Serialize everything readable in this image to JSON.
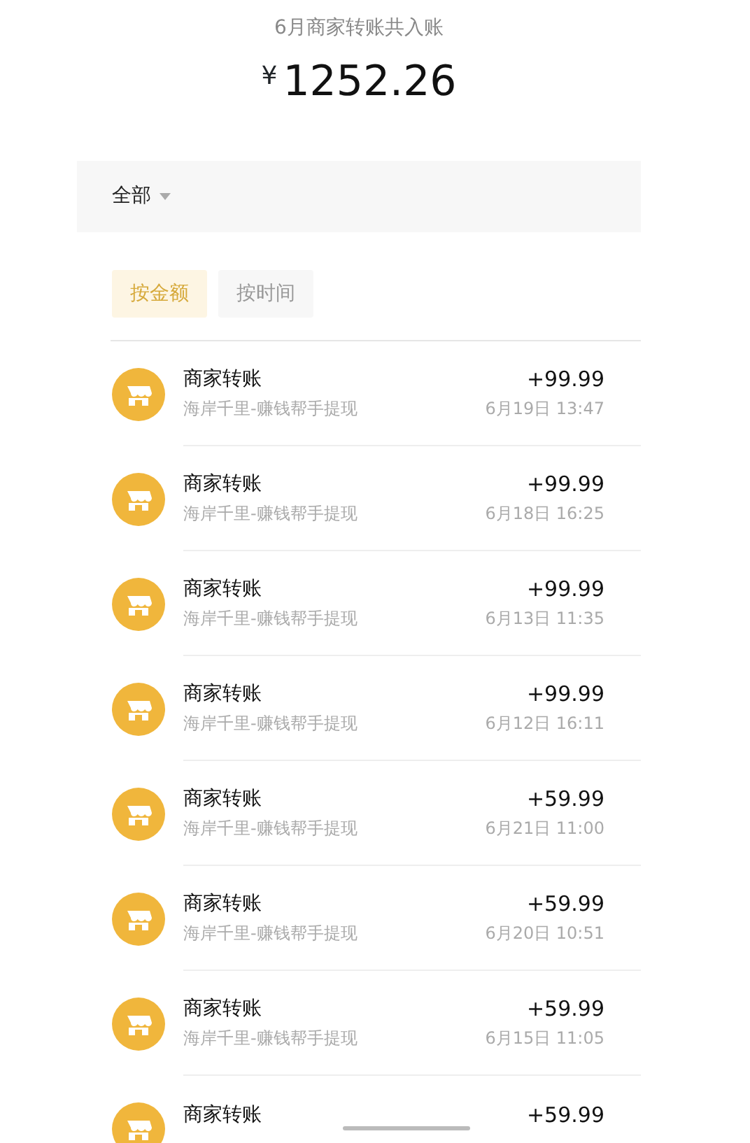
{
  "summary": {
    "title": "6月商家转账共入账",
    "currency": "¥",
    "amount": "1252.26"
  },
  "filter": {
    "label": "全部"
  },
  "sort_tabs": [
    {
      "label": "按金额",
      "selected": true
    },
    {
      "label": "按时间",
      "selected": false
    }
  ],
  "transactions": [
    {
      "title": "商家转账",
      "subtitle": "海岸千里-赚钱帮手提现",
      "amount": "+99.99",
      "time": "6月19日 13:47"
    },
    {
      "title": "商家转账",
      "subtitle": "海岸千里-赚钱帮手提现",
      "amount": "+99.99",
      "time": "6月18日 16:25"
    },
    {
      "title": "商家转账",
      "subtitle": "海岸千里-赚钱帮手提现",
      "amount": "+99.99",
      "time": "6月13日 11:35"
    },
    {
      "title": "商家转账",
      "subtitle": "海岸千里-赚钱帮手提现",
      "amount": "+99.99",
      "time": "6月12日 16:11"
    },
    {
      "title": "商家转账",
      "subtitle": "海岸千里-赚钱帮手提现",
      "amount": "+59.99",
      "time": "6月21日 11:00"
    },
    {
      "title": "商家转账",
      "subtitle": "海岸千里-赚钱帮手提现",
      "amount": "+59.99",
      "time": "6月20日 10:51"
    },
    {
      "title": "商家转账",
      "subtitle": "海岸千里-赚钱帮手提现",
      "amount": "+59.99",
      "time": "6月15日 11:05"
    },
    {
      "title": "商家转账",
      "amount": "+59.99"
    }
  ]
}
